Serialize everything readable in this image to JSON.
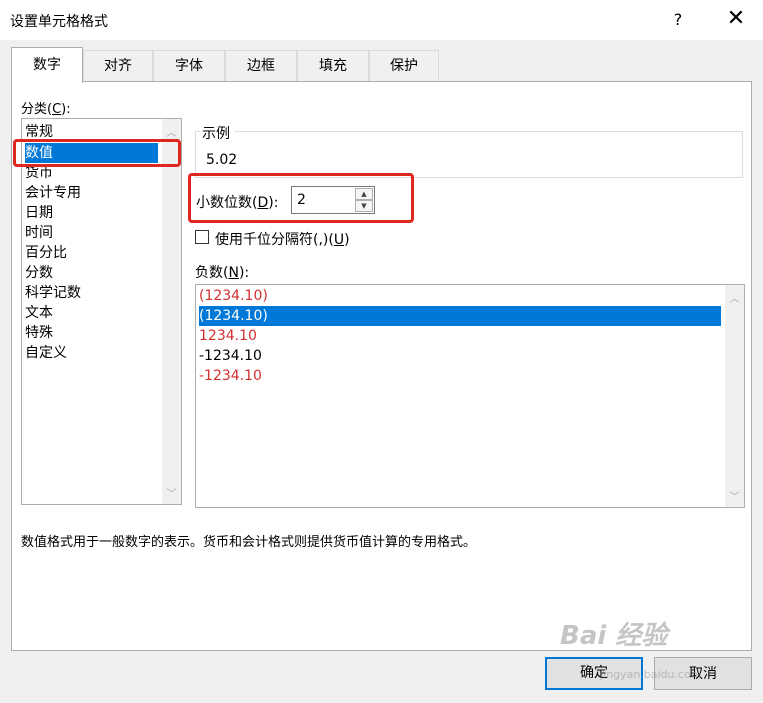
{
  "window": {
    "title": "设置单元格格式",
    "help_label": "?",
    "close_label": "✕"
  },
  "tabs": [
    {
      "label": "数字",
      "active": true
    },
    {
      "label": "对齐",
      "active": false
    },
    {
      "label": "字体",
      "active": false
    },
    {
      "label": "边框",
      "active": false
    },
    {
      "label": "填充",
      "active": false
    },
    {
      "label": "保护",
      "active": false
    }
  ],
  "category": {
    "label_prefix": "分类(",
    "label_key": "C",
    "label_suffix": "):",
    "items": [
      "常规",
      "数值",
      "货币",
      "会计专用",
      "日期",
      "时间",
      "百分比",
      "分数",
      "科学记数",
      "文本",
      "特殊",
      "自定义"
    ],
    "selected": "数值"
  },
  "sample": {
    "title": "示例",
    "value": "5.02"
  },
  "decimal_places": {
    "label_prefix": "小数位数(",
    "label_key": "D",
    "label_suffix": "):",
    "value": "2"
  },
  "thousands_separator": {
    "label_prefix": "使用千位分隔符(,)(",
    "label_key": "U",
    "label_suffix": ")",
    "checked": false
  },
  "negative_numbers": {
    "label_prefix": "负数(",
    "label_key": "N",
    "label_suffix": "):",
    "items": [
      {
        "text": "(1234.10)",
        "color": "#d32f2f",
        "selected": false
      },
      {
        "text": "(1234.10)",
        "color": "#000000",
        "selected": true
      },
      {
        "text": "1234.10",
        "color": "#d32f2f",
        "selected": false
      },
      {
        "text": "-1234.10",
        "color": "#000000",
        "selected": false
      },
      {
        "text": "-1234.10",
        "color": "#d32f2f",
        "selected": false
      }
    ]
  },
  "description": "数值格式用于一般数字的表示。货币和会计格式则提供货币值计算的专用格式。",
  "buttons": {
    "ok": "确定",
    "cancel": "取消"
  },
  "watermark": {
    "brand": "Bai 经验",
    "url": "jingyan.baidu.com"
  },
  "colors": {
    "selection": "#0078d7",
    "highlight": "#e0271f",
    "negative_red": "#d32f2f"
  }
}
